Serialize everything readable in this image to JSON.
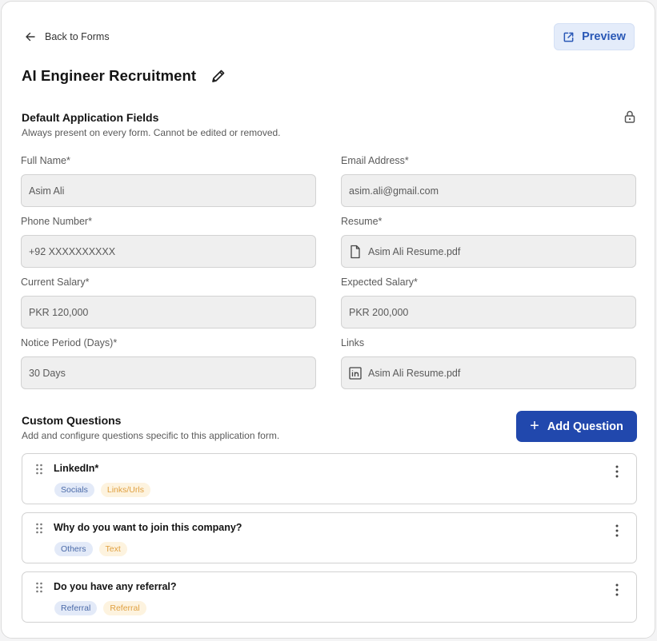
{
  "nav": {
    "back_label": "Back to Forms",
    "preview_label": "Preview"
  },
  "page": {
    "title": "AI Engineer Recruitment"
  },
  "default_section": {
    "title": "Default Application Fields",
    "subtitle": "Always present on every form. Cannot be edited or removed.",
    "fields": [
      {
        "label": "Full Name*",
        "value": "Asim Ali",
        "icon": ""
      },
      {
        "label": "Email Address*",
        "value": "asim.ali@gmail.com",
        "icon": ""
      },
      {
        "label": "Phone Number*",
        "value": "+92 XXXXXXXXXX",
        "icon": ""
      },
      {
        "label": "Resume*",
        "value": "Asim Ali Resume.pdf",
        "icon": "file-icon"
      },
      {
        "label": "Current Salary*",
        "value": "PKR 120,000",
        "icon": ""
      },
      {
        "label": "Expected Salary*",
        "value": "PKR 200,000",
        "icon": ""
      },
      {
        "label": "Notice Period (Days)*",
        "value": "30 Days",
        "icon": ""
      },
      {
        "label": "Links",
        "value": "Asim Ali Resume.pdf",
        "icon": "linkedin-icon"
      }
    ]
  },
  "custom_section": {
    "title": "Custom Questions",
    "subtitle": "Add and configure questions specific to this application form.",
    "add_label": "Add Question",
    "questions": [
      {
        "title": "LinkedIn*",
        "category": "Socials",
        "type": "Links/Urls"
      },
      {
        "title": "Why do you want to join this company?",
        "category": "Others",
        "type": "Text"
      },
      {
        "title": "Do you have any referral?",
        "category": "Referral",
        "type": "Referral"
      }
    ]
  },
  "colors": {
    "primary": "#2148ad",
    "preview_bg": "#e4ecfa",
    "field_bg": "#efefef",
    "tag_blue": "#e3eaf8",
    "tag_yellow": "#fdf3df"
  }
}
